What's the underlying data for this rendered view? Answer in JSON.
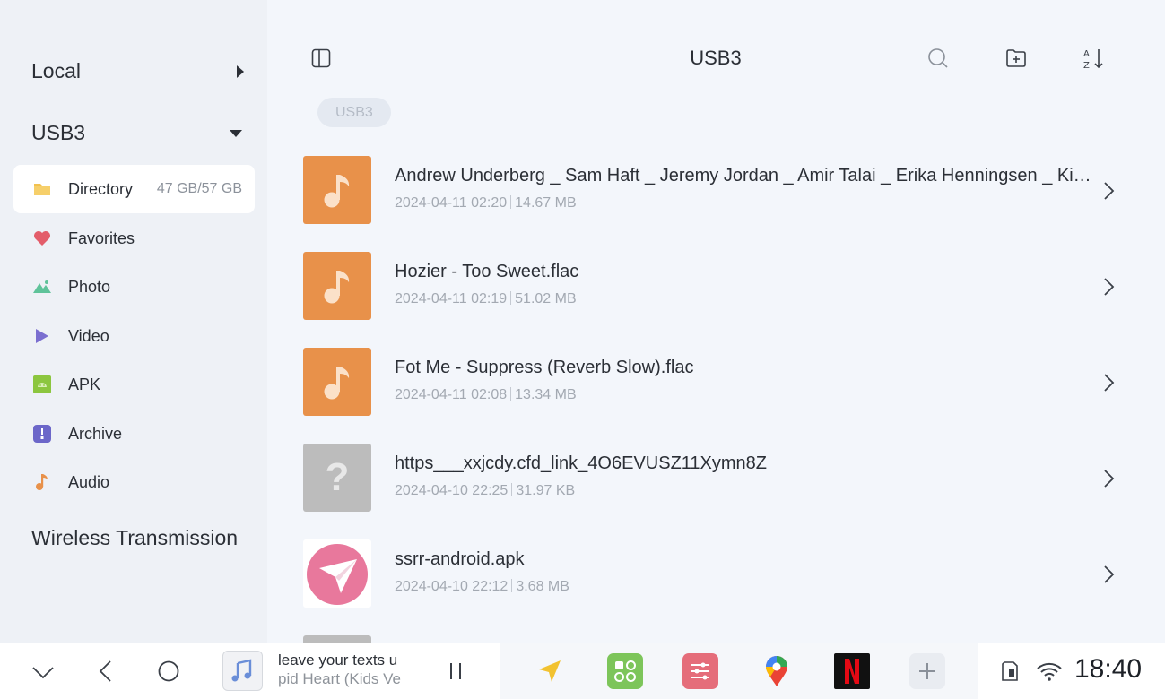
{
  "sidebar": {
    "local_label": "Local",
    "usb_label": "USB3",
    "items": [
      {
        "label": "Directory",
        "caption": "47 GB/57 GB"
      },
      {
        "label": "Favorites"
      },
      {
        "label": "Photo"
      },
      {
        "label": "Video"
      },
      {
        "label": "APK"
      },
      {
        "label": "Archive"
      },
      {
        "label": "Audio"
      }
    ],
    "wireless_label": "Wireless Transmission"
  },
  "header": {
    "title": "USB3",
    "breadcrumb": "USB3"
  },
  "files": [
    {
      "name": "Andrew Underberg _ Sam Haft _ Jeremy Jordan _ Amir Talai _ Erika Henningsen _ Kimiko Glenn - Cupid Heart (Kids Version).flac",
      "date": "2024-04-11 02:20",
      "size": "14.67 MB",
      "kind": "audio"
    },
    {
      "name": "Hozier - Too Sweet.flac",
      "date": "2024-04-11 02:19",
      "size": "51.02 MB",
      "kind": "audio"
    },
    {
      "name": "Fot Me - Suppress (Reverb Slow).flac",
      "date": "2024-04-11 02:08",
      "size": "13.34 MB",
      "kind": "audio"
    },
    {
      "name": "https___xxjcdy.cfd_link_4O6EVUSZ11Xymn8Z",
      "date": "2024-04-10 22:25",
      "size": "31.97 KB",
      "kind": "unknown"
    },
    {
      "name": "ssrr-android.apk",
      "date": "2024-04-10 22:12",
      "size": "3.68 MB",
      "kind": "apk"
    }
  ],
  "unknown_glyph": "?",
  "bottombar": {
    "media_line1": "leave your texts u",
    "media_line2": "pid Heart (Kids Ve",
    "clock": "18:40"
  },
  "colors": {
    "accent_audio": "#e8914a",
    "sidebar_bg": "#eef1f6",
    "main_bg": "#f3f6fb"
  }
}
